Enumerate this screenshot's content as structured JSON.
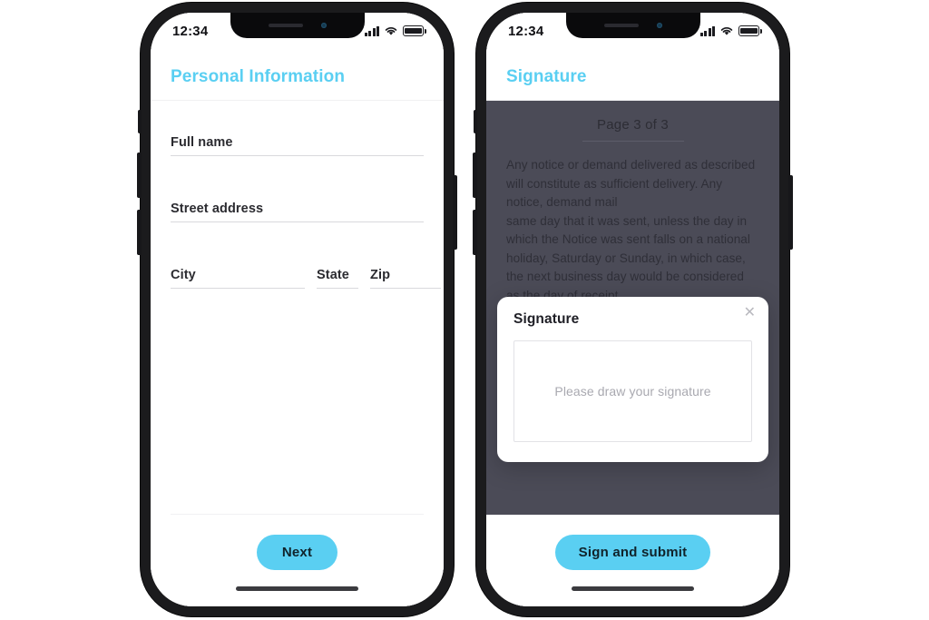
{
  "status_bar": {
    "time": "12:34",
    "signal_icon": "cellular-signal-icon",
    "wifi_icon": "wifi-icon",
    "battery_icon": "battery-icon"
  },
  "colors": {
    "accent": "#5ACFF2",
    "document_overlay": "#4B4B57",
    "text_dark": "#2B2B30",
    "field_line": "#D9D9DD"
  },
  "phone_one": {
    "header": {
      "title": "Personal Information"
    },
    "form": {
      "fields": [
        {
          "label": "Full name",
          "value": "",
          "name": "full-name-field"
        },
        {
          "label": "Street address",
          "value": "",
          "name": "street-address-field"
        }
      ],
      "row": [
        {
          "label": "City",
          "value": "",
          "name": "city-field"
        },
        {
          "label": "State",
          "value": "",
          "name": "state-field"
        },
        {
          "label": "Zip",
          "value": "",
          "name": "zip-field"
        }
      ]
    },
    "footer": {
      "next_label": "Next"
    }
  },
  "phone_two": {
    "header": {
      "title": "Signature"
    },
    "document": {
      "page_label": "Page 3 of 3",
      "paragraph_top": "Any notice or demand delivered as described will constitute as sufficient delivery. Any notice, demand mail",
      "paragraph_bottom": "same day that it was sent, unless the day in which the Notice was sent falls on a national holiday, Saturday or Sunday, in which case, the next business day would be considered as the day of receipt."
    },
    "modal": {
      "title": "Signature",
      "close_icon": "close-icon",
      "signature_pad_placeholder": "Please draw your signature"
    },
    "footer": {
      "submit_label": "Sign and submit"
    }
  }
}
